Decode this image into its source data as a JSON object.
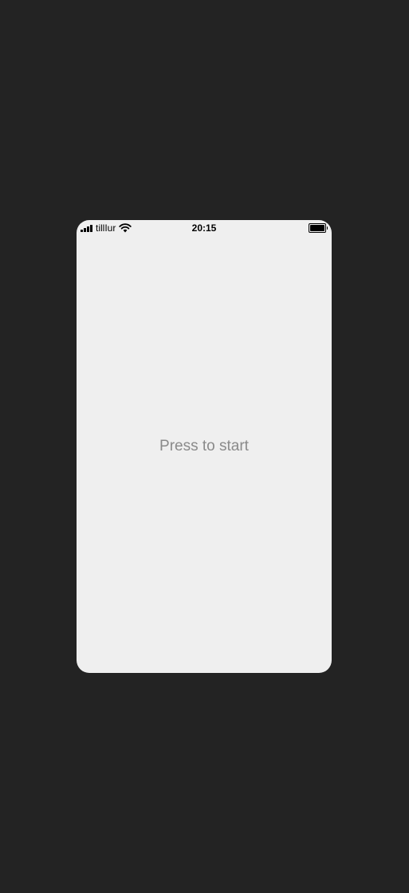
{
  "status_bar": {
    "carrier": "tillIur",
    "time": "20:15",
    "signal_icon": "cellular-signal-icon",
    "wifi_icon": "wifi-icon",
    "battery_icon": "battery-icon",
    "battery_level": 1.0
  },
  "main": {
    "start_label": "Press to start"
  },
  "colors": {
    "background": "#232323",
    "screen": "#efefef",
    "prompt_text": "#8a8a8a"
  }
}
